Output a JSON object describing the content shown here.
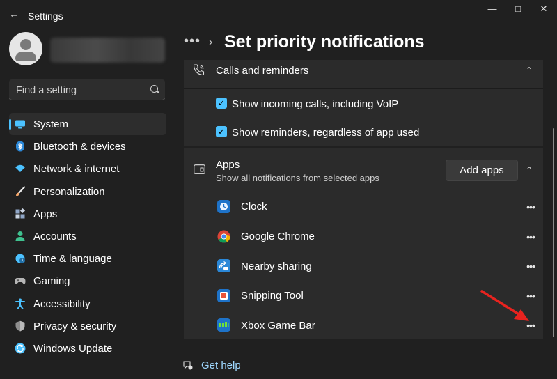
{
  "window": {
    "title": "Settings"
  },
  "search": {
    "placeholder": "Find a setting"
  },
  "sidebar": {
    "items": [
      {
        "label": "System",
        "icon": "system-icon",
        "color": "#4cc2ff"
      },
      {
        "label": "Bluetooth & devices",
        "icon": "bluetooth-icon",
        "color": "#2b88d8"
      },
      {
        "label": "Network & internet",
        "icon": "wifi-icon",
        "color": "#4cc2ff"
      },
      {
        "label": "Personalization",
        "icon": "brush-icon",
        "color": "#f7a86b"
      },
      {
        "label": "Apps",
        "icon": "apps-icon",
        "color": "#8fa6c7"
      },
      {
        "label": "Accounts",
        "icon": "accounts-icon",
        "color": "#3fc18f"
      },
      {
        "label": "Time & language",
        "icon": "globe-icon",
        "color": "#4cc2ff"
      },
      {
        "label": "Gaming",
        "icon": "gamepad-icon",
        "color": "#b5b5b5"
      },
      {
        "label": "Accessibility",
        "icon": "accessibility-icon",
        "color": "#4cc2ff"
      },
      {
        "label": "Privacy & security",
        "icon": "shield-icon",
        "color": "#8e8e8e"
      },
      {
        "label": "Windows Update",
        "icon": "update-icon",
        "color": "#4cc2ff"
      }
    ]
  },
  "breadcrumb": {
    "dots": "•••",
    "title": "Set priority notifications"
  },
  "calls": {
    "header": "Calls and reminders",
    "options": [
      {
        "label": "Show incoming calls, including VoIP",
        "checked": true
      },
      {
        "label": "Show reminders, regardless of app used",
        "checked": true
      }
    ]
  },
  "apps_section": {
    "title": "Apps",
    "subtitle": "Show all notifications from selected apps",
    "add_button": "Add apps",
    "apps": [
      {
        "name": "Clock",
        "icon": "clock-icon"
      },
      {
        "name": "Google Chrome",
        "icon": "chrome-icon"
      },
      {
        "name": "Nearby sharing",
        "icon": "nearby-sharing-icon"
      },
      {
        "name": "Snipping Tool",
        "icon": "snipping-tool-icon"
      },
      {
        "name": "Xbox Game Bar",
        "icon": "xbox-game-bar-icon"
      }
    ]
  },
  "help": {
    "label": "Get help"
  },
  "colors": {
    "accent": "#4cc2ff",
    "annotation_arrow": "#e8231f"
  }
}
